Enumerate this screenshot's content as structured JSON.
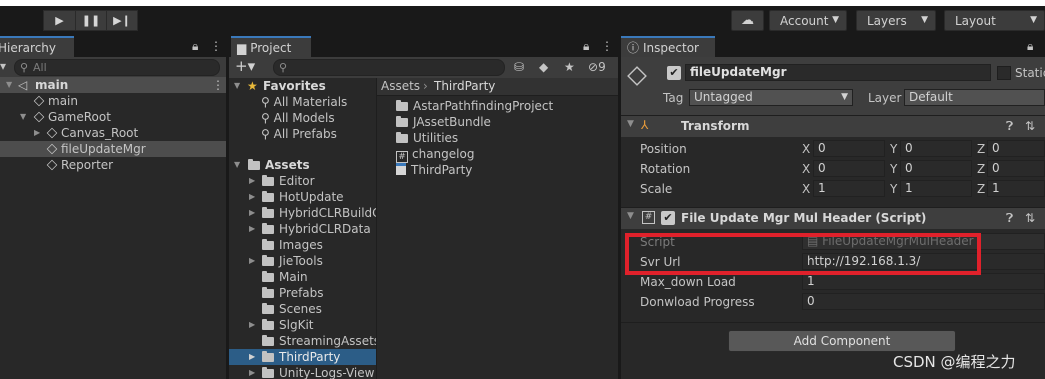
{
  "toolbar": {
    "account_label": "Account",
    "layers_label": "Layers",
    "layout_label": "Layout"
  },
  "hierarchy": {
    "tab_label": "Hierarchy",
    "search_placeholder": "All",
    "scene_name": "main",
    "items": [
      {
        "label": "main"
      },
      {
        "label": "GameRoot"
      },
      {
        "label": "Canvas_Root"
      },
      {
        "label": "fileUpdateMgr"
      },
      {
        "label": "Reporter"
      }
    ]
  },
  "project": {
    "tab_label": "Project",
    "hidden_count": "9",
    "favorites_label": "Favorites",
    "favorites": [
      "All Materials",
      "All Models",
      "All Prefabs"
    ],
    "assets_label": "Assets",
    "asset_folders": [
      "Editor",
      "HotUpdate",
      "HybridCLRBuildC",
      "HybridCLRData",
      "Images",
      "JieTools",
      "Main",
      "Prefabs",
      "Scenes",
      "SlgKit",
      "StreamingAssets",
      "ThirdParty",
      "Unity-Logs-View"
    ],
    "breadcrumb_root": "Assets",
    "breadcrumb_current": "ThirdParty",
    "contents": [
      {
        "label": "AstarPathfindingProject",
        "icon": "folder-icon"
      },
      {
        "label": "JAssetBundle",
        "icon": "folder-icon"
      },
      {
        "label": "Utilities",
        "icon": "folder-icon"
      },
      {
        "label": "changelog",
        "icon": "script-icon"
      },
      {
        "label": "ThirdParty",
        "icon": "text-file-icon"
      }
    ]
  },
  "inspector": {
    "tab_label": "Inspector",
    "object_name": "fileUpdateMgr",
    "static_label": "Static",
    "tag_label": "Tag",
    "tag_value": "Untagged",
    "layer_label": "Layer",
    "layer_value": "Default",
    "transform": {
      "title": "Transform",
      "rows": [
        {
          "label": "Position",
          "x": "0",
          "y": "0",
          "z": "0"
        },
        {
          "label": "Rotation",
          "x": "0",
          "y": "0",
          "z": "0"
        },
        {
          "label": "Scale",
          "x": "1",
          "y": "1",
          "z": "1"
        }
      ],
      "x_label": "X",
      "y_label": "Y",
      "z_label": "Z"
    },
    "script_component": {
      "title": "File Update Mgr Mul Header (Script)",
      "script_label": "Script",
      "script_value": "FileUpdateMgrMulHeader",
      "svr_url_label": "Svr Url",
      "svr_url_value": "http://192.168.1.3/",
      "max_down_label": "Max_down Load",
      "max_down_value": "1",
      "progress_label": "Donwload Progress",
      "progress_value": "0"
    },
    "add_component_label": "Add Component"
  },
  "watermark": "CSDN @编程之力",
  "colors": {
    "accent_selection": "#2c5d87",
    "highlight_box": "#e0212b"
  }
}
